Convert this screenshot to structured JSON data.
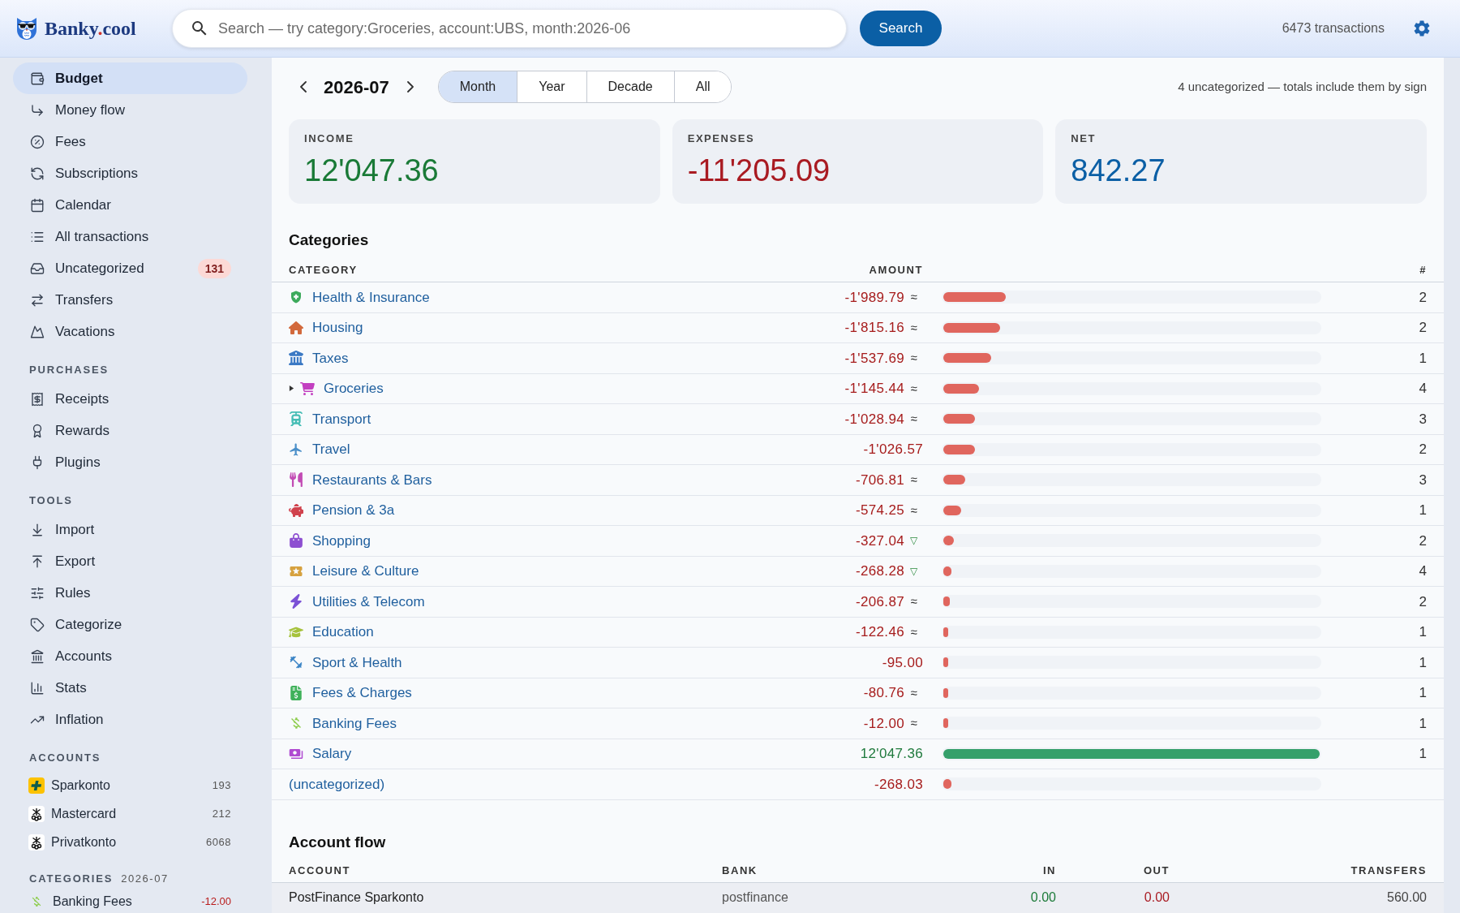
{
  "header": {
    "logo": {
      "name": "Banky",
      "separator": ".",
      "suffix": "cool"
    },
    "search": {
      "placeholder": "Search — try category:Groceries, account:UBS, month:2026-06"
    },
    "search_button": "Search",
    "transaction_count": "6473 transactions"
  },
  "sidebar": {
    "sections": [
      {
        "items": [
          {
            "label": "Budget",
            "selected": true
          },
          {
            "label": "Money flow",
            "selected": false
          },
          {
            "label": "Fees",
            "selected": false
          },
          {
            "label": "Subscriptions",
            "selected": false
          },
          {
            "label": "Calendar",
            "selected": false
          },
          {
            "label": "All transactions",
            "selected": false
          },
          {
            "label": "Uncategorized",
            "selected": false,
            "badge": "131"
          },
          {
            "label": "Transfers",
            "selected": false
          },
          {
            "label": "Vacations",
            "selected": false
          }
        ]
      },
      {
        "heading": "PURCHASES",
        "items": [
          {
            "label": "Receipts",
            "selected": false
          },
          {
            "label": "Rewards",
            "selected": false
          },
          {
            "label": "Plugins",
            "selected": false
          }
        ]
      },
      {
        "heading": "TOOLS",
        "items": [
          {
            "label": "Import",
            "selected": false
          },
          {
            "label": "Export",
            "selected": false
          },
          {
            "label": "Rules",
            "selected": false
          },
          {
            "label": "Categorize",
            "selected": false
          },
          {
            "label": "Accounts",
            "selected": false
          },
          {
            "label": "Stats",
            "selected": false
          },
          {
            "label": "Inflation",
            "selected": false
          }
        ]
      }
    ],
    "accounts": {
      "heading": "ACCOUNTS",
      "items": [
        {
          "name": "Sparkonto",
          "count": "193",
          "kind": "cross"
        },
        {
          "name": "Mastercard",
          "count": "212",
          "kind": "keys"
        },
        {
          "name": "Privatkonto",
          "count": "6068",
          "kind": "keys"
        }
      ]
    },
    "categories": {
      "heading": "CATEGORIES",
      "period": "2026-07",
      "items": [
        {
          "name": "Banking Fees",
          "amount": "-12.00",
          "color": "#8ccc4a"
        }
      ]
    }
  },
  "main": {
    "period": "2026-07",
    "ranges": [
      {
        "label": "Month",
        "selected": true
      },
      {
        "label": "Year",
        "selected": false
      },
      {
        "label": "Decade",
        "selected": false
      },
      {
        "label": "All",
        "selected": false
      }
    ],
    "note": "4 uncategorized — totals include them by sign",
    "cards": [
      {
        "label": "INCOME",
        "value": "12'047.36",
        "kind": "income"
      },
      {
        "label": "EXPENSES",
        "value": "-11'205.09",
        "kind": "expense"
      },
      {
        "label": "NET",
        "value": "842.27",
        "kind": "net"
      }
    ],
    "categories": {
      "title": "Categories",
      "columns": [
        "CATEGORY",
        "AMOUNT",
        "#"
      ],
      "rows": [
        {
          "name": "Health & Insurance",
          "amount": "-1'989.79",
          "trend": {
            "mark": "≈",
            "kind": "similar"
          },
          "level": 0.165,
          "count": "2",
          "color": "#3daa5c",
          "kind": "expense"
        },
        {
          "name": "Housing",
          "amount": "-1'815.16",
          "trend": {
            "mark": "≈",
            "kind": "similar"
          },
          "level": 0.151,
          "count": "2",
          "color": "#d2693c",
          "kind": "expense"
        },
        {
          "name": "Taxes",
          "amount": "-1'537.69",
          "trend": {
            "mark": "≈",
            "kind": "similar"
          },
          "level": 0.128,
          "count": "1",
          "color": "#3b79c4",
          "kind": "expense"
        },
        {
          "name": "Groceries",
          "expanded": false,
          "amount": "-1'145.44",
          "trend": {
            "mark": "≈",
            "kind": "similar"
          },
          "level": 0.095,
          "count": "4",
          "color": "#c23fc0",
          "kind": "expense"
        },
        {
          "name": "Transport",
          "amount": "-1'028.94",
          "trend": {
            "mark": "≈",
            "kind": "similar"
          },
          "level": 0.085,
          "count": "3",
          "color": "#45bdb5",
          "kind": "expense"
        },
        {
          "name": "Travel",
          "amount": "-1'026.57",
          "level": 0.085,
          "count": "2",
          "color": "#4a8fc9",
          "kind": "expense"
        },
        {
          "name": "Restaurants & Bars",
          "amount": "-706.81",
          "trend": {
            "mark": "≈",
            "kind": "similar"
          },
          "level": 0.059,
          "count": "3",
          "color": "#c24bb4",
          "kind": "expense"
        },
        {
          "name": "Pension & 3a",
          "amount": "-574.25",
          "trend": {
            "mark": "≈",
            "kind": "similar"
          },
          "level": 0.048,
          "count": "1",
          "color": "#d0424d",
          "kind": "expense"
        },
        {
          "name": "Shopping",
          "amount": "-327.04",
          "trend": {
            "mark": "▽",
            "kind": "lower"
          },
          "level": 0.027,
          "count": "2",
          "color": "#8d4fd1",
          "kind": "expense"
        },
        {
          "name": "Leisure & Culture",
          "amount": "-268.28",
          "trend": {
            "mark": "▽",
            "kind": "lower"
          },
          "level": 0.022,
          "count": "4",
          "color": "#d6a13f",
          "kind": "expense"
        },
        {
          "name": "Utilities & Telecom",
          "amount": "-206.87",
          "trend": {
            "mark": "≈",
            "kind": "similar"
          },
          "level": 0.017,
          "count": "2",
          "color": "#7b52d6",
          "kind": "expense"
        },
        {
          "name": "Education",
          "amount": "-122.46",
          "trend": {
            "mark": "≈",
            "kind": "similar"
          },
          "level": 0.01,
          "count": "1",
          "color": "#a6c23c",
          "kind": "expense"
        },
        {
          "name": "Sport & Health",
          "amount": "-95.00",
          "level": 0.008,
          "count": "1",
          "color": "#3c85c6",
          "kind": "expense"
        },
        {
          "name": "Fees & Charges",
          "amount": "-80.76",
          "trend": {
            "mark": "≈",
            "kind": "similar"
          },
          "level": 0.007,
          "count": "1",
          "color": "#3fb15a",
          "kind": "expense"
        },
        {
          "name": "Banking Fees",
          "amount": "-12.00",
          "trend": {
            "mark": "≈",
            "kind": "similar"
          },
          "level": 0.001,
          "count": "1",
          "color": "#8ccc4a",
          "kind": "expense"
        },
        {
          "name": "Salary",
          "amount": "12'047.36",
          "level": 1,
          "count": "1",
          "color": "#b04bd1",
          "kind": "income"
        },
        {
          "name": "(uncategorized)",
          "amount": "-268.03",
          "level": 0.022,
          "kind": "expense"
        }
      ]
    },
    "account_flow": {
      "title": "Account flow",
      "columns": [
        "ACCOUNT",
        "BANK",
        "IN",
        "OUT",
        "TRANSFERS"
      ],
      "rows": [
        {
          "account": "PostFinance Sparkonto",
          "bank": "postfinance",
          "in": "0.00",
          "out": "0.00",
          "transfers": "560.00"
        }
      ]
    }
  }
}
